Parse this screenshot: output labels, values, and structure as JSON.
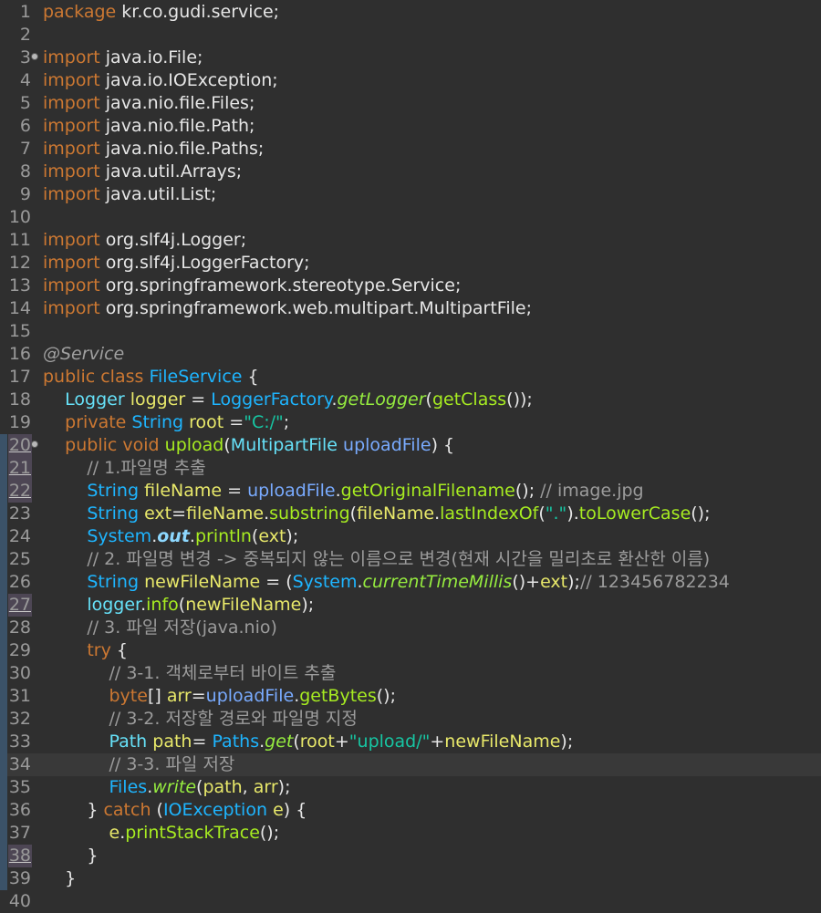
{
  "editor": {
    "language": "java",
    "current_line": 34,
    "changed_lines": [
      20,
      21,
      22,
      27,
      38
    ],
    "lines": [
      {
        "n": "1",
        "tokens": [
          [
            "kw",
            "package"
          ],
          [
            "plain",
            " kr.co.gudi.service;"
          ]
        ]
      },
      {
        "n": "2",
        "tokens": []
      },
      {
        "n": "3",
        "fold": true,
        "tokens": [
          [
            "kw",
            "import"
          ],
          [
            "plain",
            " java.io.File;"
          ]
        ]
      },
      {
        "n": "4",
        "tokens": [
          [
            "kw",
            "import"
          ],
          [
            "plain",
            " java.io.IOException;"
          ]
        ]
      },
      {
        "n": "5",
        "tokens": [
          [
            "kw",
            "import"
          ],
          [
            "plain",
            " java.nio.file.Files;"
          ]
        ]
      },
      {
        "n": "6",
        "tokens": [
          [
            "kw",
            "import"
          ],
          [
            "plain",
            " java.nio.file.Path;"
          ]
        ]
      },
      {
        "n": "7",
        "tokens": [
          [
            "kw",
            "import"
          ],
          [
            "plain",
            " java.nio.file.Paths;"
          ]
        ]
      },
      {
        "n": "8",
        "tokens": [
          [
            "kw",
            "import"
          ],
          [
            "plain",
            " java.util.Arrays;"
          ]
        ]
      },
      {
        "n": "9",
        "tokens": [
          [
            "kw",
            "import"
          ],
          [
            "plain",
            " java.util.List;"
          ]
        ]
      },
      {
        "n": "10",
        "tokens": []
      },
      {
        "n": "11",
        "tokens": [
          [
            "kw",
            "import"
          ],
          [
            "plain",
            " org.slf4j.Logger;"
          ]
        ]
      },
      {
        "n": "12",
        "tokens": [
          [
            "kw",
            "import"
          ],
          [
            "plain",
            " org.slf4j.LoggerFactory;"
          ]
        ]
      },
      {
        "n": "13",
        "tokens": [
          [
            "kw",
            "import"
          ],
          [
            "plain",
            " org.springframework.stereotype.Service;"
          ]
        ]
      },
      {
        "n": "14",
        "tokens": [
          [
            "kw",
            "import"
          ],
          [
            "plain",
            " org.springframework.web.multipart.MultipartFile;"
          ]
        ]
      },
      {
        "n": "15",
        "tokens": []
      },
      {
        "n": "16",
        "tokens": [
          [
            "anno",
            "@Service"
          ]
        ]
      },
      {
        "n": "17",
        "tokens": [
          [
            "kw",
            "public"
          ],
          [
            "plain",
            " "
          ],
          [
            "kw",
            "class"
          ],
          [
            "plain",
            " "
          ],
          [
            "type",
            "FileService"
          ],
          [
            "plain",
            " {"
          ]
        ]
      },
      {
        "n": "18",
        "tokens": [
          [
            "plain",
            "    "
          ],
          [
            "var",
            "Logger"
          ],
          [
            "plain",
            " "
          ],
          [
            "field",
            "logger"
          ],
          [
            "plain",
            " = "
          ],
          [
            "type",
            "LoggerFactory"
          ],
          [
            "plain",
            "."
          ],
          [
            "static",
            "getLogger"
          ],
          [
            "plain",
            "("
          ],
          [
            "method",
            "getClass"
          ],
          [
            "plain",
            "());"
          ]
        ]
      },
      {
        "n": "19",
        "tokens": [
          [
            "plain",
            "    "
          ],
          [
            "kw",
            "private"
          ],
          [
            "plain",
            " "
          ],
          [
            "type",
            "String"
          ],
          [
            "plain",
            " "
          ],
          [
            "field",
            "root"
          ],
          [
            "plain",
            " ="
          ],
          [
            "string",
            "\"C:/\""
          ],
          [
            "plain",
            ";"
          ]
        ]
      },
      {
        "n": "20",
        "fold": true,
        "tokens": [
          [
            "plain",
            "    "
          ],
          [
            "kw",
            "public"
          ],
          [
            "plain",
            " "
          ],
          [
            "kw",
            "void"
          ],
          [
            "plain",
            " "
          ],
          [
            "method",
            "upload"
          ],
          [
            "plain",
            "("
          ],
          [
            "var",
            "MultipartFile"
          ],
          [
            "plain",
            " "
          ],
          [
            "param",
            "uploadFile"
          ],
          [
            "plain",
            ") {"
          ]
        ]
      },
      {
        "n": "21",
        "tokens": [
          [
            "plain",
            "        "
          ],
          [
            "comment",
            "// 1.파일명 추출"
          ]
        ]
      },
      {
        "n": "22",
        "tokens": [
          [
            "plain",
            "        "
          ],
          [
            "type",
            "String"
          ],
          [
            "plain",
            " "
          ],
          [
            "field",
            "fileName"
          ],
          [
            "plain",
            " = "
          ],
          [
            "param",
            "uploadFile"
          ],
          [
            "plain",
            "."
          ],
          [
            "method",
            "getOriginalFilename"
          ],
          [
            "plain",
            "(); "
          ],
          [
            "comment",
            "// image.jpg"
          ]
        ]
      },
      {
        "n": "23",
        "tokens": [
          [
            "plain",
            "        "
          ],
          [
            "type",
            "String"
          ],
          [
            "plain",
            " "
          ],
          [
            "field",
            "ext"
          ],
          [
            "plain",
            "="
          ],
          [
            "field",
            "fileName"
          ],
          [
            "plain",
            "."
          ],
          [
            "method",
            "substring"
          ],
          [
            "plain",
            "("
          ],
          [
            "field",
            "fileName"
          ],
          [
            "plain",
            "."
          ],
          [
            "method",
            "lastIndexOf"
          ],
          [
            "plain",
            "("
          ],
          [
            "string",
            "\".\""
          ],
          [
            "plain",
            ")."
          ],
          [
            "method",
            "toLowerCase"
          ],
          [
            "plain",
            "();"
          ]
        ]
      },
      {
        "n": "24",
        "tokens": [
          [
            "plain",
            "        "
          ],
          [
            "type",
            "System"
          ],
          [
            "plain",
            "."
          ],
          [
            "staticfield",
            "out"
          ],
          [
            "plain",
            "."
          ],
          [
            "method",
            "println"
          ],
          [
            "plain",
            "("
          ],
          [
            "field",
            "ext"
          ],
          [
            "plain",
            ");"
          ]
        ]
      },
      {
        "n": "25",
        "tokens": [
          [
            "plain",
            "        "
          ],
          [
            "comment",
            "// 2. 파일명 변경 -> 중복되지 않는 이름으로 변경(현재 시간을 밀리초로 환산한 이름)"
          ]
        ]
      },
      {
        "n": "26",
        "tokens": [
          [
            "plain",
            "        "
          ],
          [
            "type",
            "String"
          ],
          [
            "plain",
            " "
          ],
          [
            "field",
            "newFileName"
          ],
          [
            "plain",
            " = ("
          ],
          [
            "type",
            "System"
          ],
          [
            "plain",
            "."
          ],
          [
            "static",
            "currentTimeMillis"
          ],
          [
            "plain",
            "()+"
          ],
          [
            "field",
            "ext"
          ],
          [
            "plain",
            ");"
          ],
          [
            "comment",
            "// 123456782234"
          ]
        ]
      },
      {
        "n": "27",
        "tokens": [
          [
            "plain",
            "        "
          ],
          [
            "var",
            "logger"
          ],
          [
            "plain",
            "."
          ],
          [
            "method",
            "info"
          ],
          [
            "plain",
            "("
          ],
          [
            "field",
            "newFileName"
          ],
          [
            "plain",
            ");"
          ]
        ]
      },
      {
        "n": "28",
        "tokens": [
          [
            "plain",
            "        "
          ],
          [
            "comment",
            "// 3. 파일 저장(java.nio)"
          ]
        ]
      },
      {
        "n": "29",
        "tokens": [
          [
            "plain",
            "        "
          ],
          [
            "kw",
            "try"
          ],
          [
            "plain",
            " {"
          ]
        ]
      },
      {
        "n": "30",
        "tokens": [
          [
            "plain",
            "            "
          ],
          [
            "comment",
            "// 3-1. 객체로부터 바이트 추출"
          ]
        ]
      },
      {
        "n": "31",
        "tokens": [
          [
            "plain",
            "            "
          ],
          [
            "kw",
            "byte"
          ],
          [
            "plain",
            "[] "
          ],
          [
            "field",
            "arr"
          ],
          [
            "plain",
            "="
          ],
          [
            "param",
            "uploadFile"
          ],
          [
            "plain",
            "."
          ],
          [
            "method",
            "getBytes"
          ],
          [
            "plain",
            "();"
          ]
        ]
      },
      {
        "n": "32",
        "tokens": [
          [
            "plain",
            "            "
          ],
          [
            "comment",
            "// 3-2. 저장할 경로와 파일명 지정"
          ]
        ]
      },
      {
        "n": "33",
        "tokens": [
          [
            "plain",
            "            "
          ],
          [
            "var",
            "Path"
          ],
          [
            "plain",
            " "
          ],
          [
            "field",
            "path"
          ],
          [
            "plain",
            "= "
          ],
          [
            "type",
            "Paths"
          ],
          [
            "plain",
            "."
          ],
          [
            "static",
            "get"
          ],
          [
            "plain",
            "("
          ],
          [
            "field",
            "root"
          ],
          [
            "plain",
            "+"
          ],
          [
            "string",
            "\"upload/\""
          ],
          [
            "plain",
            "+"
          ],
          [
            "field",
            "newFileName"
          ],
          [
            "plain",
            ");"
          ]
        ]
      },
      {
        "n": "34",
        "tokens": [
          [
            "plain",
            "            "
          ],
          [
            "comment",
            "// 3-3. 파일 저장"
          ]
        ]
      },
      {
        "n": "35",
        "tokens": [
          [
            "plain",
            "            "
          ],
          [
            "type",
            "Files"
          ],
          [
            "plain",
            "."
          ],
          [
            "static",
            "write"
          ],
          [
            "plain",
            "("
          ],
          [
            "field",
            "path"
          ],
          [
            "plain",
            ", "
          ],
          [
            "field",
            "arr"
          ],
          [
            "plain",
            ");"
          ]
        ]
      },
      {
        "n": "36",
        "tokens": [
          [
            "plain",
            "        } "
          ],
          [
            "kw",
            "catch"
          ],
          [
            "plain",
            " ("
          ],
          [
            "type",
            "IOException"
          ],
          [
            "plain",
            " "
          ],
          [
            "field",
            "e"
          ],
          [
            "plain",
            ") {"
          ]
        ]
      },
      {
        "n": "37",
        "tokens": [
          [
            "plain",
            "            "
          ],
          [
            "field",
            "e"
          ],
          [
            "plain",
            "."
          ],
          [
            "method",
            "printStackTrace"
          ],
          [
            "plain",
            "();"
          ]
        ]
      },
      {
        "n": "38",
        "tokens": [
          [
            "plain",
            "        }"
          ]
        ]
      },
      {
        "n": "39",
        "tokens": [
          [
            "plain",
            "    }"
          ]
        ]
      },
      {
        "n": "40",
        "tokens": []
      }
    ]
  }
}
